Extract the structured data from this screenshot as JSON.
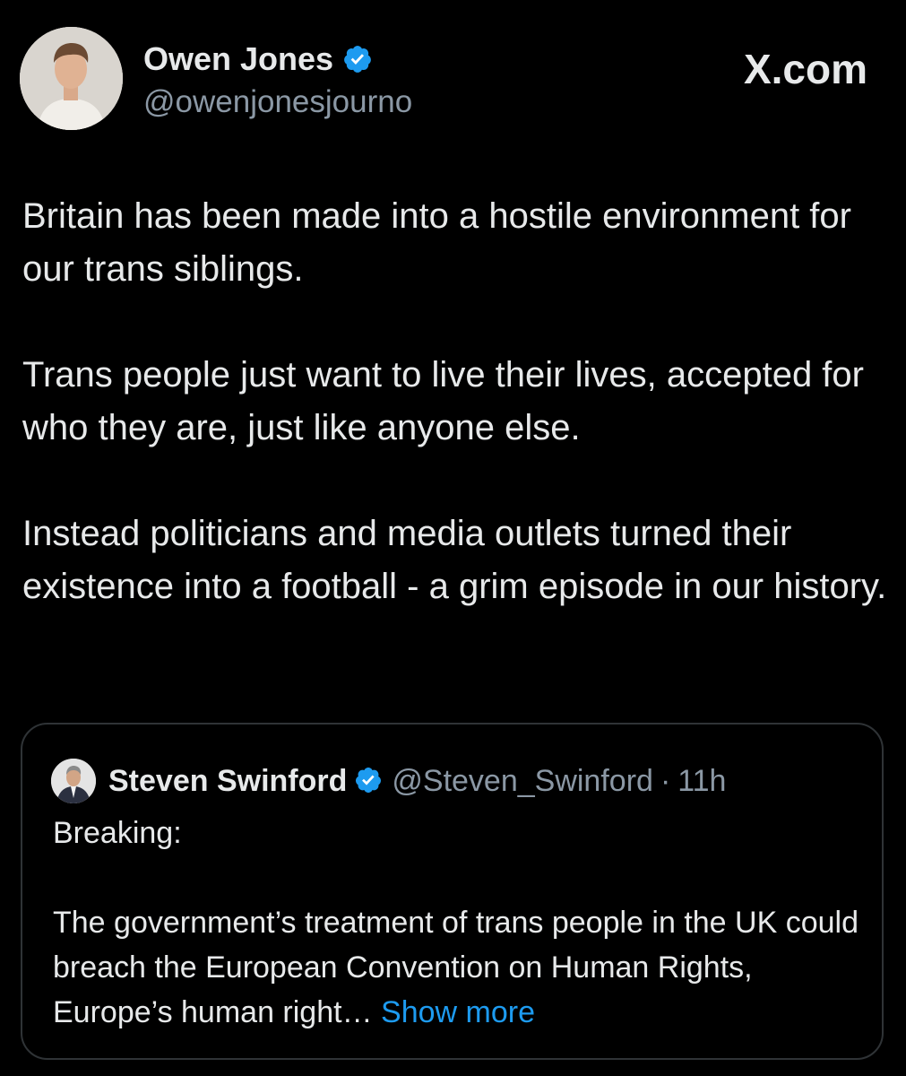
{
  "post": {
    "author": {
      "name": "Owen Jones",
      "handle": "@owenjonesjourno",
      "verified": true,
      "avatar_icon": "profile-photo"
    },
    "brand": "X.com",
    "paragraphs": [
      "Britain has been made into a hostile environment for our trans siblings.",
      "Trans people just want to live their lives, accepted for who they are, just like anyone else.",
      "Instead politicians and media outlets turned their existence into a football - a grim episode in our history."
    ]
  },
  "quote": {
    "author": {
      "name": "Steven Swinford",
      "handle": "@Steven_Swinford",
      "verified": true
    },
    "separator": "·",
    "time": "11h",
    "paragraphs": [
      "Breaking:",
      "The government’s treatment of trans people in the UK could breach the European Convention on Human Rights, Europe’s human right…"
    ],
    "show_more": "Show more"
  },
  "colors": {
    "background": "#000000",
    "text": "#e7e9ea",
    "secondary": "#8b98a5",
    "link": "#1d9bf0",
    "verified": "#1d9bf0",
    "border": "#2f3336"
  }
}
